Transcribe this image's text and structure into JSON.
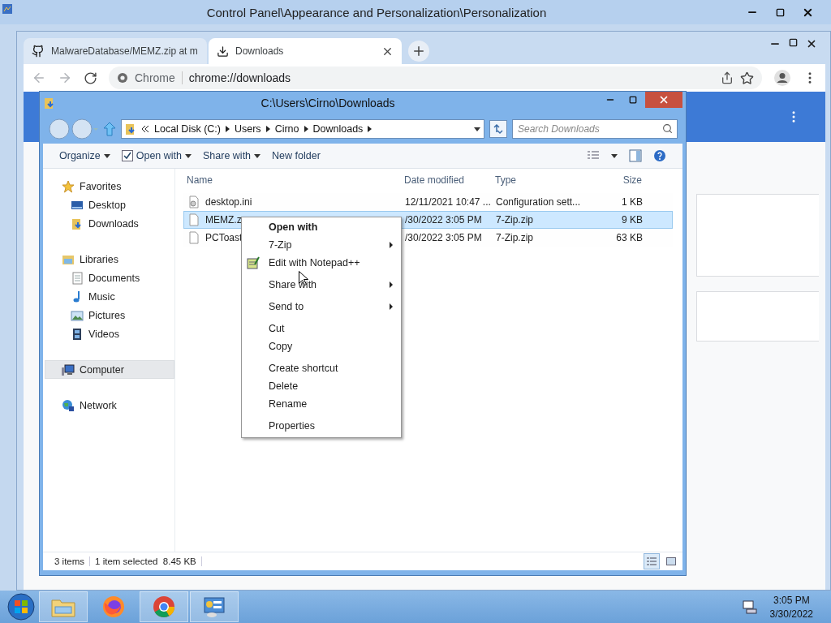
{
  "control_panel": {
    "title": "Control Panel\\Appearance and Personalization\\Personalization"
  },
  "browser": {
    "tabs": [
      {
        "label": "MalwareDatabase/MEMZ.zip at m",
        "kind": "github",
        "selected": false
      },
      {
        "label": "Downloads",
        "kind": "download",
        "selected": true
      }
    ],
    "omnibox": {
      "origin": "Chrome",
      "url": "chrome://downloads"
    }
  },
  "explorer": {
    "title": "C:\\Users\\Cirno\\Downloads",
    "breadcrumb": [
      "Local Disk (C:)",
      "Users",
      "Cirno",
      "Downloads"
    ],
    "search": {
      "placeholder": "Search Downloads"
    },
    "commands": [
      {
        "label": "Organize",
        "kind": "plain",
        "dropdown": true
      },
      {
        "label": "Open with",
        "kind": "checkbox",
        "dropdown": true
      },
      {
        "label": "Share with",
        "kind": "plain",
        "dropdown": true
      },
      {
        "label": "New folder",
        "kind": "plain",
        "dropdown": false
      }
    ],
    "nav": [
      {
        "label": "Favorites",
        "kind": "star",
        "selected": false,
        "children": [
          {
            "label": "Desktop",
            "kind": "desktop",
            "selected": false
          },
          {
            "label": "Downloads",
            "kind": "downloads",
            "selected": false
          }
        ]
      },
      {
        "label": "Libraries",
        "kind": "library",
        "selected": false,
        "children": [
          {
            "label": "Documents",
            "kind": "document",
            "selected": false
          },
          {
            "label": "Music",
            "kind": "music",
            "selected": false
          },
          {
            "label": "Pictures",
            "kind": "picture",
            "selected": false
          },
          {
            "label": "Videos",
            "kind": "video",
            "selected": false
          }
        ]
      },
      {
        "label": "Computer",
        "kind": "computer",
        "selected": true
      },
      {
        "label": "Network",
        "kind": "network",
        "selected": false
      }
    ],
    "columns": [
      "Name",
      "Date modified",
      "Type",
      "Size"
    ],
    "files": [
      {
        "name": "desktop.ini",
        "date": "12/11/2021 10:47 ...",
        "type": "Configuration sett...",
        "size": "1 KB",
        "kind": "settings",
        "selected": false
      },
      {
        "name": "MEMZ.z",
        "date": "/30/2022 3:05 PM",
        "type": "7-Zip.zip",
        "size": "9 KB",
        "kind": "blank",
        "selected": true
      },
      {
        "name": "PCToast",
        "date": "/30/2022 3:05 PM",
        "type": "7-Zip.zip",
        "size": "63 KB",
        "kind": "blank",
        "selected": false
      }
    ],
    "status": {
      "count": "3 items",
      "selection": "1 item selected",
      "size": "8.45 KB"
    }
  },
  "context_menu": {
    "groups": [
      {
        "items": [
          {
            "label": "Open with",
            "default": true,
            "submenu": false
          },
          {
            "label": "7-Zip",
            "default": false,
            "submenu": true
          },
          {
            "label": "Edit with Notepad++",
            "default": false,
            "submenu": false,
            "kind": "notepad"
          }
        ]
      },
      {
        "items": [
          {
            "label": "Share with",
            "default": false,
            "submenu": true
          }
        ]
      },
      {
        "items": [
          {
            "label": "Send to",
            "default": false,
            "submenu": true
          }
        ]
      },
      {
        "items": [
          {
            "label": "Cut",
            "default": false,
            "submenu": false
          },
          {
            "label": "Copy",
            "default": false,
            "submenu": false
          }
        ]
      },
      {
        "items": [
          {
            "label": "Create shortcut",
            "default": false,
            "submenu": false
          },
          {
            "label": "Delete",
            "default": false,
            "submenu": false
          },
          {
            "label": "Rename",
            "default": false,
            "submenu": false
          }
        ]
      },
      {
        "items": [
          {
            "label": "Properties",
            "default": false,
            "submenu": false
          }
        ]
      }
    ]
  },
  "taskbar": {
    "apps": [
      {
        "kind": "explorer",
        "open": true
      },
      {
        "kind": "firefox",
        "open": false
      },
      {
        "kind": "chrome",
        "open": true
      },
      {
        "kind": "control-panel",
        "open": true
      }
    ],
    "time": "3:05 PM",
    "date": "3/30/2022"
  }
}
